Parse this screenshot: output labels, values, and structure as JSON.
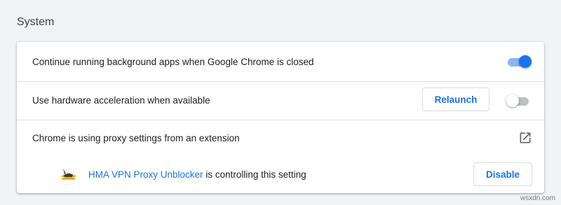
{
  "section": {
    "title": "System"
  },
  "rows": {
    "background_apps": {
      "label": "Continue running background apps when Google Chrome is closed",
      "toggle_on": true
    },
    "hardware_accel": {
      "label": "Use hardware acceleration when available",
      "button_label": "Relaunch",
      "toggle_on": false
    },
    "proxy": {
      "label": "Chrome is using proxy settings from an extension",
      "icon": "open-in-new-icon"
    },
    "extension": {
      "icon": "hma-donkey-icon",
      "name": "HMA VPN Proxy Unblocker",
      "suffix": " is controlling this setting",
      "button_label": "Disable"
    }
  },
  "colors": {
    "accent": "#1a73e8",
    "toggle_track_on": "#8ab4f8",
    "toggle_track_off": "#bdc1c6",
    "page_background": "#f1f3f4"
  },
  "watermark": "wsxdn.com"
}
